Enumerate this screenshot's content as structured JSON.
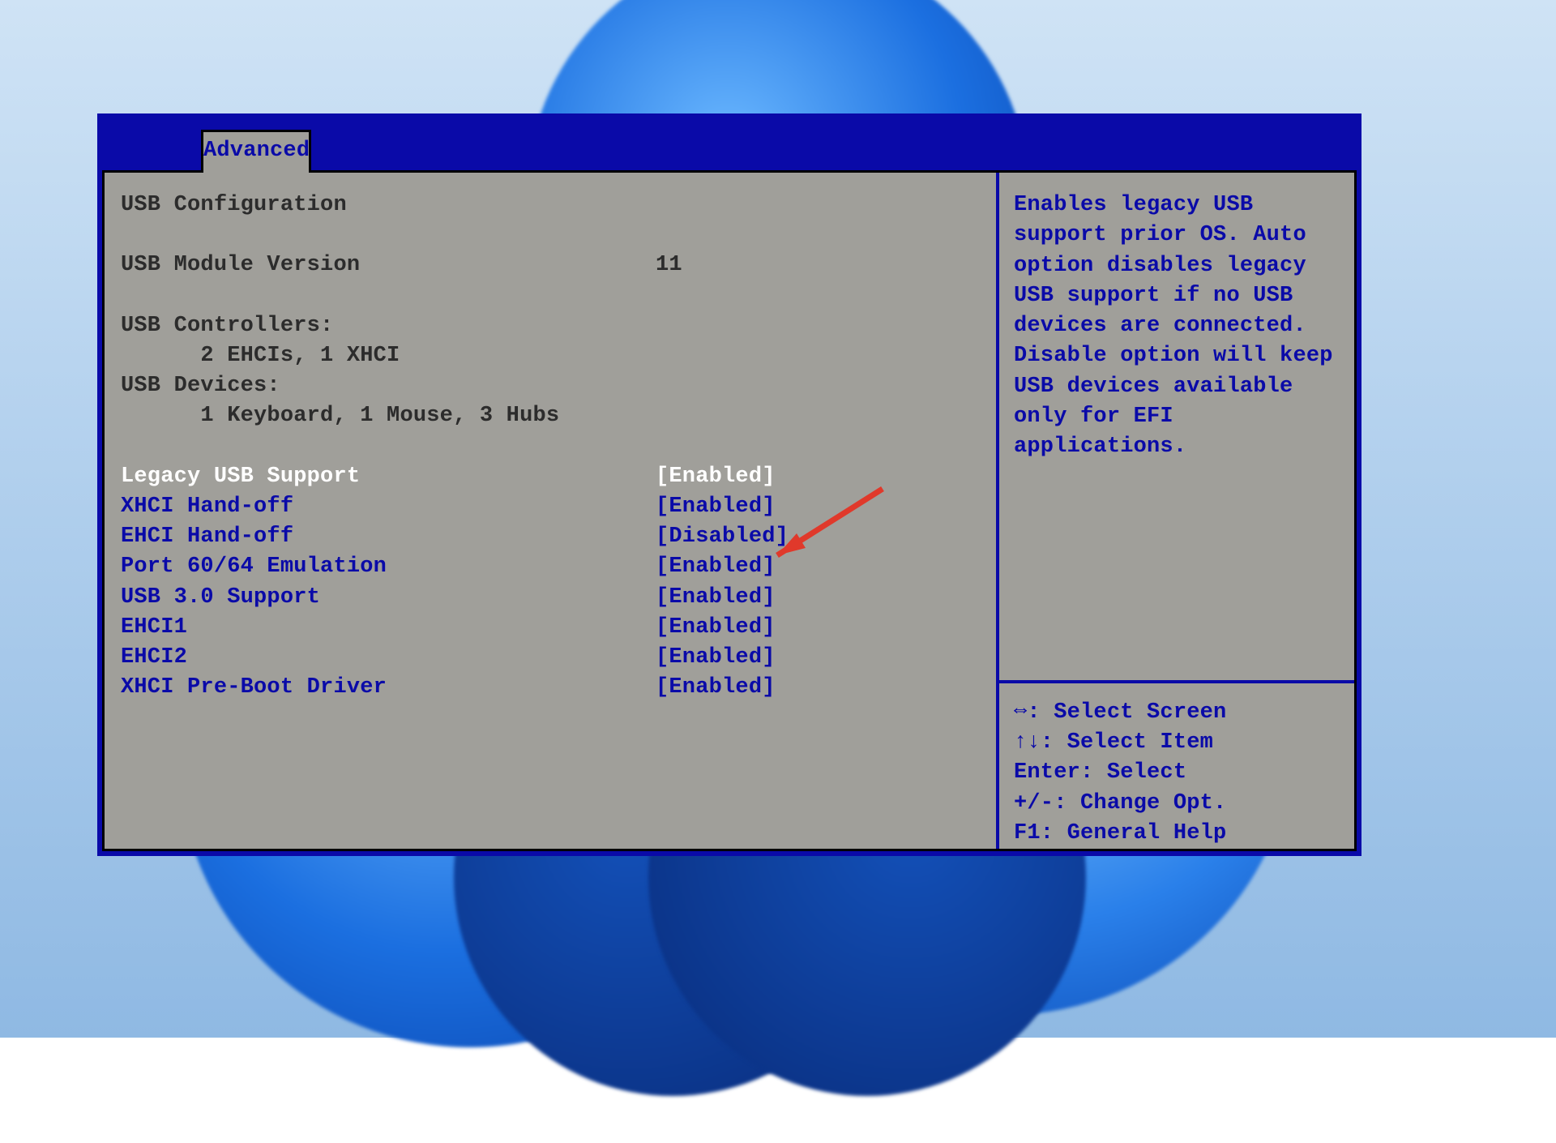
{
  "tab": "Advanced",
  "section_title": "USB Configuration",
  "module_version": {
    "label": "USB Module Version",
    "value": "11"
  },
  "controllers": {
    "label": "USB Controllers:",
    "value": "2 EHCIs, 1 XHCI"
  },
  "devices": {
    "label": "USB Devices:",
    "value": "1 Keyboard, 1 Mouse, 3 Hubs"
  },
  "options": [
    {
      "label": "Legacy USB Support",
      "value": "[Enabled]",
      "selected": true
    },
    {
      "label": "XHCI Hand-off",
      "value": "[Enabled]",
      "selected": false
    },
    {
      "label": "EHCI Hand-off",
      "value": "[Disabled]",
      "selected": false
    },
    {
      "label": "Port 60/64 Emulation",
      "value": "[Enabled]",
      "selected": false
    },
    {
      "label": "USB 3.0 Support",
      "value": "[Enabled]",
      "selected": false
    },
    {
      "label": "EHCI1",
      "value": "[Enabled]",
      "selected": false
    },
    {
      "label": "EHCI2",
      "value": "[Enabled]",
      "selected": false
    },
    {
      "label": "XHCI Pre-Boot Driver",
      "value": "[Enabled]",
      "selected": false
    }
  ],
  "help_text": "Enables legacy USB support prior OS. Auto option disables legacy USB support if no USB devices are connected. Disable option will keep USB devices available only for EFI applications.",
  "hints": [
    "⇔: Select Screen",
    "↑↓: Select Item",
    "Enter: Select",
    "+/-: Change Opt.",
    "F1: General Help"
  ]
}
